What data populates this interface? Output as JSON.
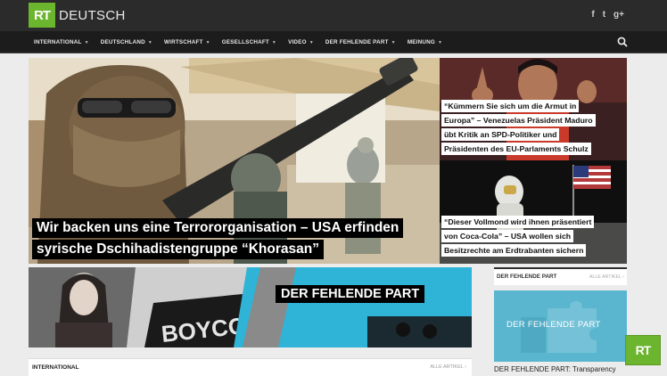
{
  "brand": {
    "logo_badge": "RT",
    "logo_text": "DEUTSCH"
  },
  "social": {
    "facebook": "f",
    "twitter": "t",
    "googleplus": "g+"
  },
  "nav": [
    {
      "label": "INTERNATIONAL"
    },
    {
      "label": "DEUTSCHLAND"
    },
    {
      "label": "WIRTSCHAFT"
    },
    {
      "label": "GESELLSCHAFT"
    },
    {
      "label": "VIDEO"
    },
    {
      "label": "DER FEHLENDE PART"
    },
    {
      "label": "MEINUNG"
    }
  ],
  "hero": {
    "lines": [
      "Wir backen uns eine Terrororganisation – USA erfinden",
      "syrische Dschihadistengruppe “Khorasan”"
    ]
  },
  "side_stories": [
    {
      "lines": [
        "“Kümmern Sie sich um die Armut in",
        "Europa” – Venezuelas Präsident Maduro",
        "übt Kritik an SPD-Politiker und",
        "Präsidenten des EU-Parlaments Schulz"
      ]
    },
    {
      "lines": [
        "“Dieser Vollmond wird ihnen präsentiert",
        "von Coca-Cola” – USA wollen sich",
        "Besitzrechte am Erdtrabanten sichern"
      ]
    }
  ],
  "banner": {
    "title": "DER FEHLENDE PART"
  },
  "ticker": {
    "label": "INTERNATIONAL",
    "link": "ALLE ARTIKEL ›"
  },
  "widget": {
    "label": "DER FEHLENDE PART",
    "link": "ALLE ARTIKEL ›",
    "image_title": "DER FEHLENDE PART",
    "caption": "DER FEHLENDE PART: Transparency"
  },
  "badge": {
    "label": "RT"
  },
  "colors": {
    "brand_green": "#6cb52e",
    "topbar": "#2b2b2b",
    "navbar": "#1c1c1c",
    "banner_cyan": "#2fb3d6"
  }
}
